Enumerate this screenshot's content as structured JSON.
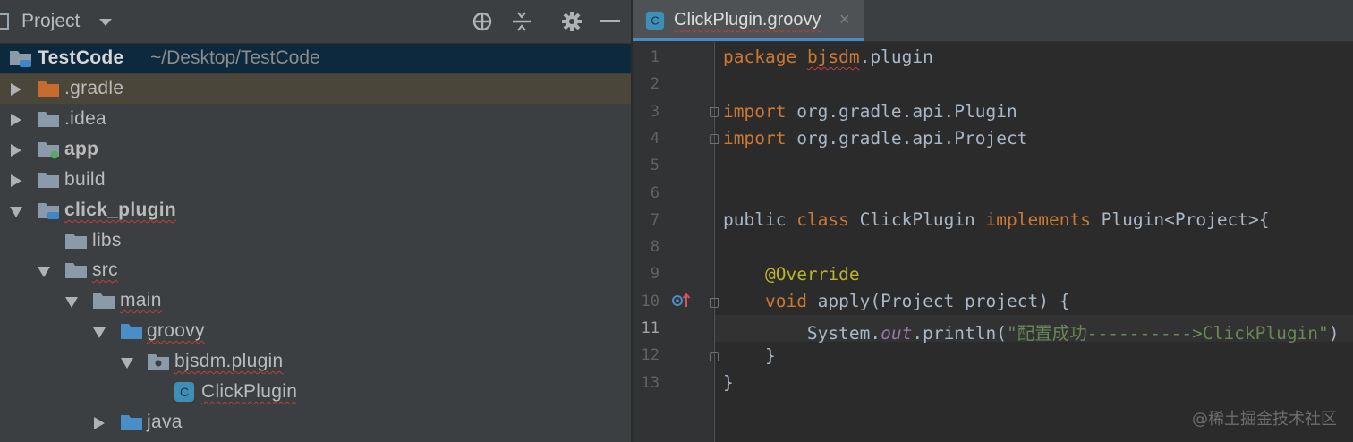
{
  "project_panel": {
    "title": "Project",
    "toolbar_icons": [
      "locate-icon",
      "collapse-all-icon",
      "gear-icon",
      "minimize-icon"
    ],
    "root": {
      "name": "TestCode",
      "path": "~/Desktop/TestCode"
    },
    "tree": [
      {
        "label": ".gradle",
        "icon": "folder-orange-icon",
        "expanded": false
      },
      {
        "label": ".idea",
        "icon": "folder-icon",
        "expanded": false
      },
      {
        "label": "app",
        "icon": "module-folder-icon",
        "expanded": false
      },
      {
        "label": "build",
        "icon": "folder-icon",
        "expanded": false
      },
      {
        "label": "click_plugin",
        "icon": "module-folder-icon",
        "expanded": true
      },
      {
        "label": "libs",
        "icon": "folder-icon"
      },
      {
        "label": "src",
        "icon": "folder-icon",
        "expanded": true
      },
      {
        "label": "main",
        "icon": "folder-icon",
        "expanded": true
      },
      {
        "label": "groovy",
        "icon": "source-folder-icon",
        "expanded": true
      },
      {
        "label": "bjsdm.plugin",
        "icon": "package-icon",
        "expanded": true
      },
      {
        "label": "ClickPlugin",
        "icon": "groovy-class-icon"
      },
      {
        "label": "java",
        "icon": "source-folder-icon",
        "expanded": false
      }
    ]
  },
  "editor": {
    "tab": {
      "label": "ClickPlugin.groovy",
      "icon": "groovy-class-icon",
      "close": "×"
    },
    "line_numbers": [
      "1",
      "2",
      "3",
      "4",
      "5",
      "6",
      "7",
      "8",
      "9",
      "10",
      "11",
      "12",
      "13"
    ],
    "current_line": "11",
    "code": {
      "l1_kw": "package",
      "l1_pkg": "bjsdm",
      "l1_rest": ".plugin",
      "l3_kw": "import",
      "l3_rest": " org.gradle.api.Plugin",
      "l4_kw": "import",
      "l4_rest": " org.gradle.api.Project",
      "l7_public": "public",
      "l7_class": "class",
      "l7_name": " ClickPlugin ",
      "l7_impl": "implements",
      "l7_rest": " Plugin<Project>{",
      "l9_ann": "@Override",
      "l10_kw": "void",
      "l10_rest": " apply(Project project) {",
      "l11_a": "System.",
      "l11_out": "out",
      "l11_b": ".println(",
      "l11_str": "\"配置成功---------->ClickPlugin\"",
      "l11_c": ")",
      "l12": "}",
      "l13": "}"
    }
  },
  "watermark": "@稀土掘金技术社区"
}
